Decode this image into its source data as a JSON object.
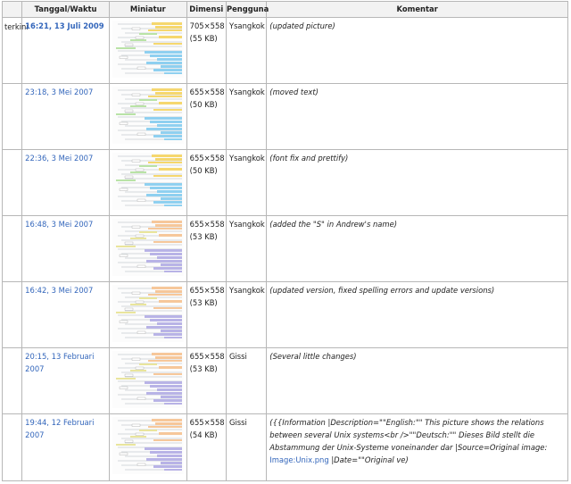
{
  "headers": {
    "status": "",
    "date": "Tanggal/Waktu",
    "thumb": "Miniatur",
    "dim": "Dimensi",
    "user": "Pengguna",
    "comment": "Komentar"
  },
  "rows": [
    {
      "status": "terkini",
      "date": "16:21, 13 Juli 2009",
      "is_current": true,
      "dim": "705×558",
      "size": "(55 KB)",
      "user": "Ysangkok",
      "comment": "(updated picture)",
      "palette": "yellow-blue"
    },
    {
      "status": "",
      "date": "23:18, 3 Mei 2007",
      "is_current": false,
      "dim": "655×558",
      "size": "(50 KB)",
      "user": "Ysangkok",
      "comment": "(moved text)",
      "palette": "yellow-blue"
    },
    {
      "status": "",
      "date": "22:36, 3 Mei 2007",
      "is_current": false,
      "dim": "655×558",
      "size": "(50 KB)",
      "user": "Ysangkok",
      "comment": "(font fix and prettify)",
      "palette": "yellow-blue"
    },
    {
      "status": "",
      "date": "16:48, 3 Mei 2007",
      "is_current": false,
      "dim": "655×558",
      "size": "(53 KB)",
      "user": "Ysangkok",
      "comment": "(added the \"S\" in Andrew's name)",
      "palette": "orange-purple"
    },
    {
      "status": "",
      "date": "16:42, 3 Mei 2007",
      "is_current": false,
      "dim": "655×558",
      "size": "(53 KB)",
      "user": "Ysangkok",
      "comment": "(updated version, fixed spelling errors and update versions)",
      "palette": "orange-purple"
    },
    {
      "status": "",
      "date": "20:15, 13 Februari 2007",
      "is_current": false,
      "dim": "655×558",
      "size": "(53 KB)",
      "user": "Gissi",
      "comment": "(Several little changes)",
      "palette": "orange-purple"
    },
    {
      "status": "",
      "date": "19:44, 12 Februari 2007",
      "is_current": false,
      "dim": "655×558",
      "size": "(54 KB)",
      "user": "Gissi",
      "comment": "({{Information |Description=\"\"English:\"\" This picture shows the relations between several Unix systems<br />\"\"Deutsch:\"\" Dieses Bild stellt die Abstammung der Unix-Systeme voneinander dar |Source=Original image: ",
      "comment_link": "Image:Unix.png",
      "comment_tail": " |Date=\"\"Original ve)",
      "palette": "orange-purple"
    }
  ],
  "palettes": {
    "yellow-blue": {
      "a": "#f5d76e",
      "b": "#8fd0f0",
      "c": "#b9e3a6",
      "line": "#9aa5ad"
    },
    "orange-purple": {
      "a": "#f6c79a",
      "b": "#b8b3e6",
      "c": "#e9e59c",
      "line": "#9aa5ad"
    }
  }
}
